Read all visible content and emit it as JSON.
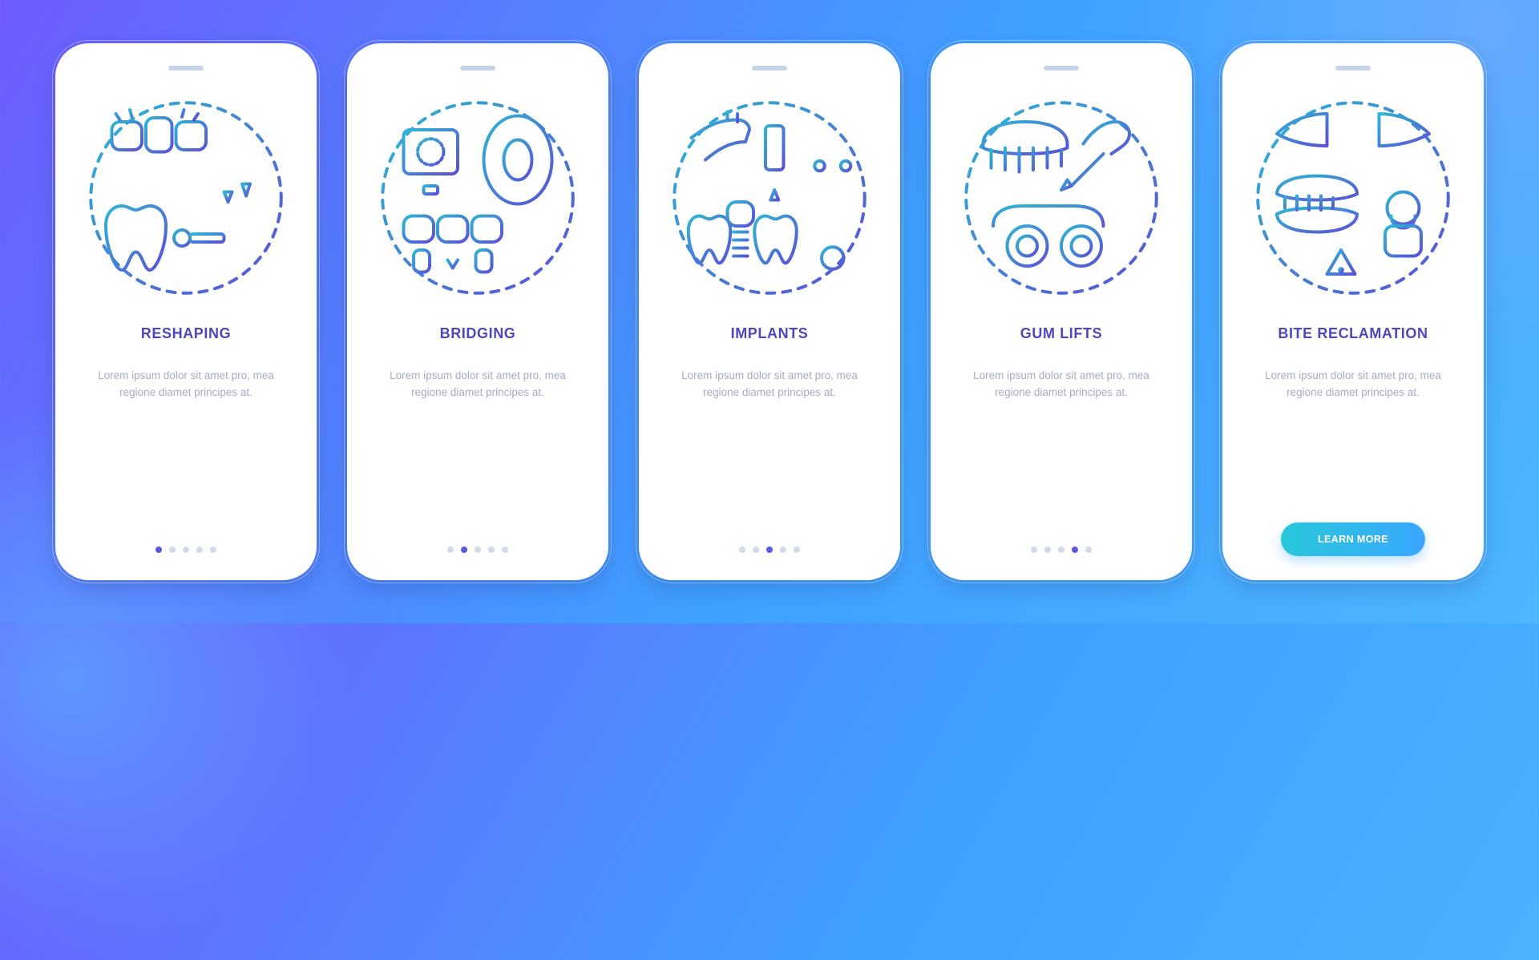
{
  "placeholder_body": "Lorem ipsum dolor sit amet pro, mea regione diamet principes at.",
  "screens": [
    {
      "title": "RESHAPING",
      "active_index": 0,
      "body_key": "placeholder_body"
    },
    {
      "title": "BRIDGING",
      "active_index": 1,
      "body_key": "placeholder_body"
    },
    {
      "title": "IMPLANTS",
      "active_index": 2,
      "body_key": "placeholder_body"
    },
    {
      "title": "GUM LIFTS",
      "active_index": 3,
      "body_key": "placeholder_body"
    },
    {
      "title": "BITE RECLAMATION",
      "active_index": 4,
      "body_key": "placeholder_body",
      "cta_label": "LEARN MORE"
    }
  ],
  "dot_count": 5
}
